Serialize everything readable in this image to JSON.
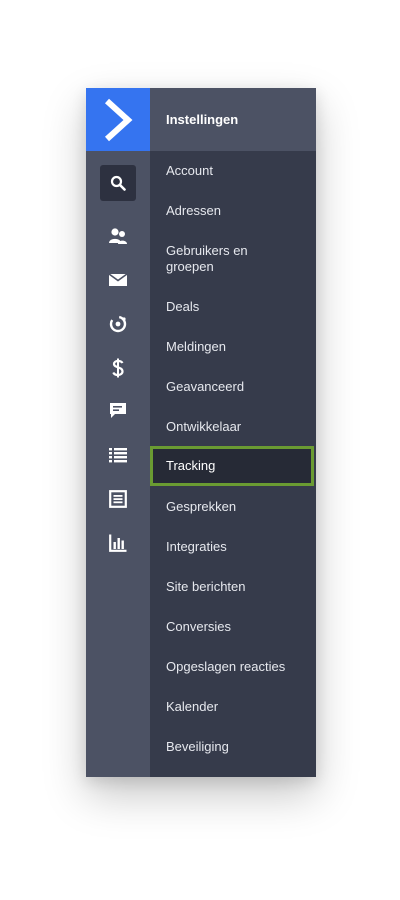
{
  "colors": {
    "brand_blue": "#3574f0",
    "rail_bg": "#4c5264",
    "panel_bg": "#363b4b",
    "active_bg": "#262a36",
    "active_border": "#6a9b32"
  },
  "rail": {
    "icons": [
      "logo-chevron-icon",
      "search-icon",
      "contacts-icon",
      "mail-icon",
      "gear-icon",
      "dollar-icon",
      "chat-icon",
      "list-icon",
      "document-icon",
      "bar-chart-icon"
    ]
  },
  "panel": {
    "title": "Instellingen",
    "items": [
      {
        "label": "Account"
      },
      {
        "label": "Adressen"
      },
      {
        "label": "Gebruikers en groepen"
      },
      {
        "label": "Deals"
      },
      {
        "label": "Meldingen"
      },
      {
        "label": "Geavanceerd"
      },
      {
        "label": "Ontwikkelaar"
      },
      {
        "label": "Tracking",
        "active": true
      },
      {
        "label": "Gesprekken"
      },
      {
        "label": "Integraties"
      },
      {
        "label": "Site berichten"
      },
      {
        "label": "Conversies"
      },
      {
        "label": "Opgeslagen reacties"
      },
      {
        "label": "Kalender"
      },
      {
        "label": "Beveiliging"
      }
    ]
  }
}
